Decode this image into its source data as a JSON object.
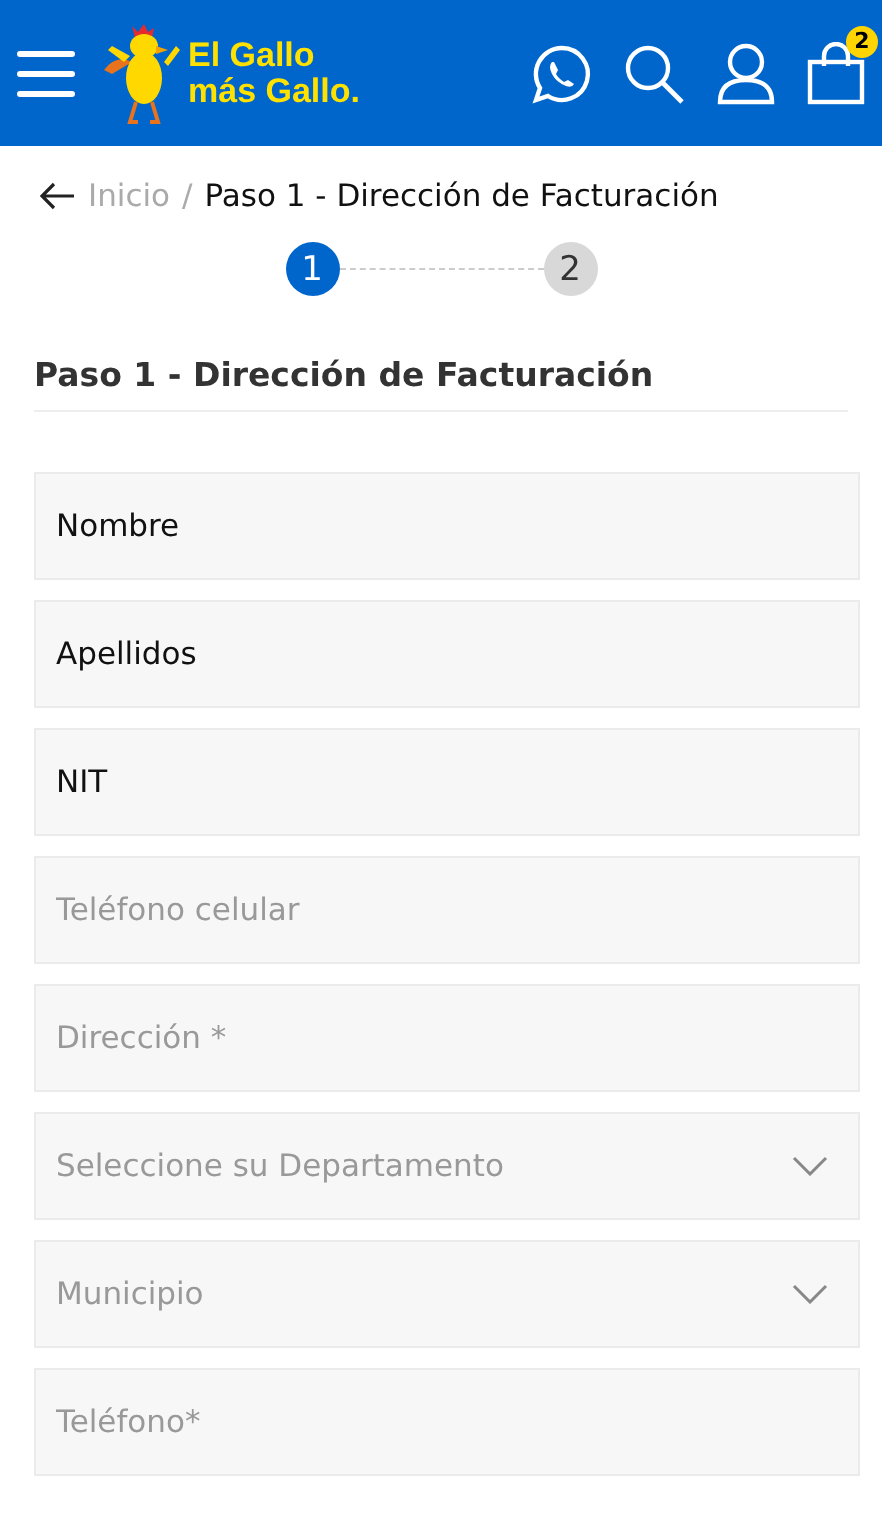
{
  "header": {
    "logo": {
      "line_1": "El Gallo",
      "line_2": "más Gallo."
    },
    "cart_count": "2"
  },
  "breadcrumb": {
    "home": "Inicio",
    "separator": "/",
    "current": "Paso 1 - Dirección de Facturación"
  },
  "stepper": [
    {
      "label": "1",
      "selected": true
    },
    {
      "label": "2",
      "selected": false
    }
  ],
  "section_title": "Paso 1 - Dirección de Facturación",
  "fields": [
    {
      "kind": "input",
      "value": "Nombre"
    },
    {
      "kind": "input",
      "value": "Apellidos"
    },
    {
      "kind": "input",
      "value": "NIT"
    },
    {
      "kind": "input",
      "placeholder": "Teléfono celular"
    },
    {
      "kind": "input",
      "placeholder": "Dirección *"
    },
    {
      "kind": "select",
      "placeholder": "Seleccione su Departamento"
    },
    {
      "kind": "select",
      "placeholder": "Municipio"
    },
    {
      "kind": "input",
      "placeholder": "Teléfono*"
    }
  ]
}
